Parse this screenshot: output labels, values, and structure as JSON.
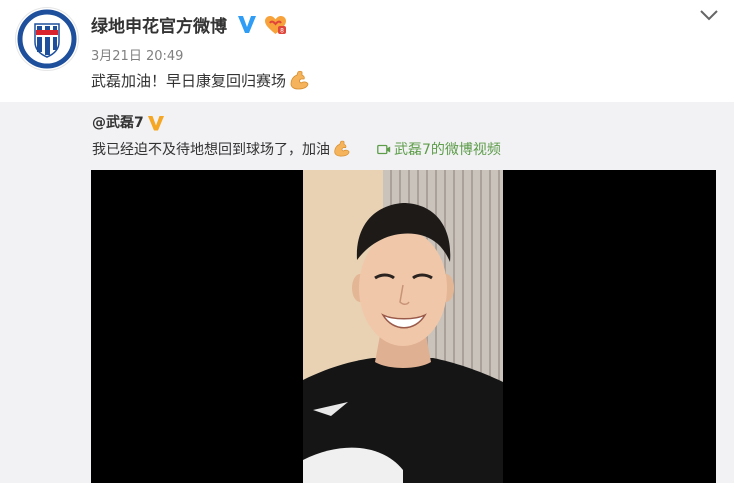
{
  "post": {
    "author_name": "绿地申花官方微博",
    "timestamp": "3月21日 20:49",
    "text": "武磊加油！早日康复回归赛场"
  },
  "repost": {
    "author_handle": "@武磊7",
    "text": "我已经迫不及待地想回到球场了，加油",
    "video_link_label": "武磊7的微博视频"
  },
  "icons": {
    "verified": "verified-v-icon",
    "vip": "vip-heart-icon",
    "more": "chevron-down-icon",
    "flexed_bicep": "flexed-biceps-icon",
    "video": "video-camera-icon"
  },
  "colors": {
    "verified_blue": "#2f9cf5",
    "verified_yellow": "#f5a623",
    "link_green": "#5d9c49",
    "repost_bg": "#f2f2f5"
  }
}
